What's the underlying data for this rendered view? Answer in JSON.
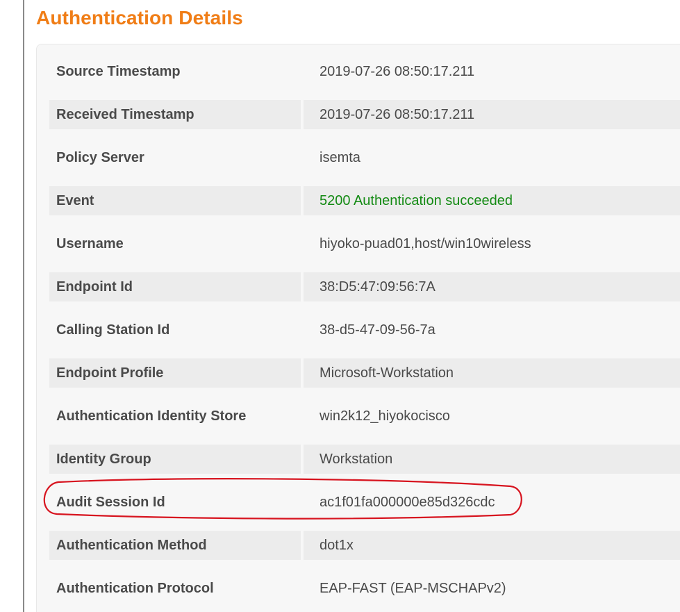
{
  "section": {
    "title": "Authentication Details"
  },
  "colors": {
    "title": "#f07d16",
    "success": "#138a13",
    "highlight": "#d7141f"
  },
  "rows": [
    {
      "label": "Source Timestamp",
      "value": "2019-07-26 08:50:17.211"
    },
    {
      "label": "Received Timestamp",
      "value": "2019-07-26 08:50:17.211"
    },
    {
      "label": "Policy Server",
      "value": "isemta"
    },
    {
      "label": "Event",
      "value": "5200 Authentication succeeded"
    },
    {
      "label": "Username",
      "value": "hiyoko-puad01,host/win10wireless"
    },
    {
      "label": "Endpoint Id",
      "value": "38:D5:47:09:56:7A"
    },
    {
      "label": "Calling Station Id",
      "value": "38-d5-47-09-56-7a"
    },
    {
      "label": "Endpoint Profile",
      "value": "Microsoft-Workstation"
    },
    {
      "label": "Authentication Identity Store",
      "value": "win2k12_hiyokocisco"
    },
    {
      "label": "Identity Group",
      "value": "Workstation"
    },
    {
      "label": "Audit Session Id",
      "value": "ac1f01fa000000e85d326cdc"
    },
    {
      "label": "Authentication Method",
      "value": "dot1x"
    },
    {
      "label": "Authentication Protocol",
      "value": "EAP-FAST (EAP-MSCHAPv2)"
    }
  ]
}
